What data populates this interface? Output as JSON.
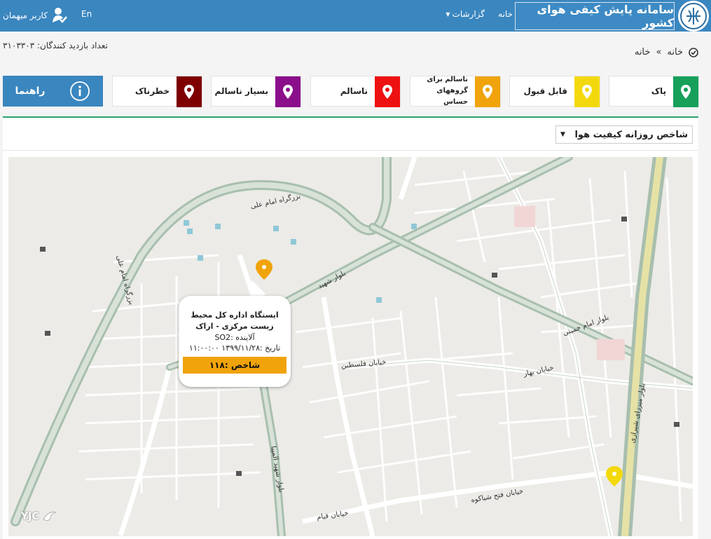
{
  "header": {
    "title": "سامانه پایش کیفی هوای کشور",
    "home_link": "خانه",
    "reports_link": "گزارشات",
    "lang_link": "En",
    "user_label": "کاربر میهمان"
  },
  "visitors": {
    "label": "تعداد بازدید کنندگان: ۳۱۰۳۳۰۳"
  },
  "breadcrumb": {
    "items": [
      "خانه",
      "خانه"
    ],
    "separator": "»"
  },
  "legend": [
    {
      "label": "پاک",
      "color": "#16a05a"
    },
    {
      "label": "قابل قبول",
      "color": "#f3d90b"
    },
    {
      "label_line1": "ناسالم برای",
      "label_line2": "گروههای حساس",
      "color": "#f0a30a"
    },
    {
      "label": "ناسالم",
      "color": "#ee1111"
    },
    {
      "label": "بسیار ناسالم",
      "color": "#8b0f8b"
    },
    {
      "label": "خطرناک",
      "color": "#7f0000"
    }
  ],
  "help_button": {
    "label": "راهنما",
    "color": "#3a86bf"
  },
  "panel": {
    "select_value": "شاخص روزانه کیفیت هوا"
  },
  "map": {
    "roads": {
      "imam_ali_highway": "بزرگراه امام علی",
      "imam_ali_highway_2": "بزرگراه امام علی",
      "blvd_shahid": "بلوار شهید",
      "falestin": "خیابان فلسطین",
      "beheshti": "خیابان بهار",
      "fath": "خیابان فتح شیاکوه",
      "ghiyam": "خیابان قیام",
      "imam_khomeini": "بلوار امام خمینی",
      "shirazi": "بلوار میرزای شیرازی",
      "olympia": "بلوار شهید المپیا",
      "ayat": "بزرگراه امام علی"
    },
    "yjc": "YJC"
  },
  "popup": {
    "station": "ایستگاه اداره کل محیط زیست مرکزی - اراک",
    "pollutant": "آلاینده :SO2",
    "date": "تاریخ :۱۳۹۹/۱۱/۲۸ ۱۱:۰۰:۰۰",
    "index": "شاخص :۱۱۸",
    "index_color": "#f0a30a"
  }
}
